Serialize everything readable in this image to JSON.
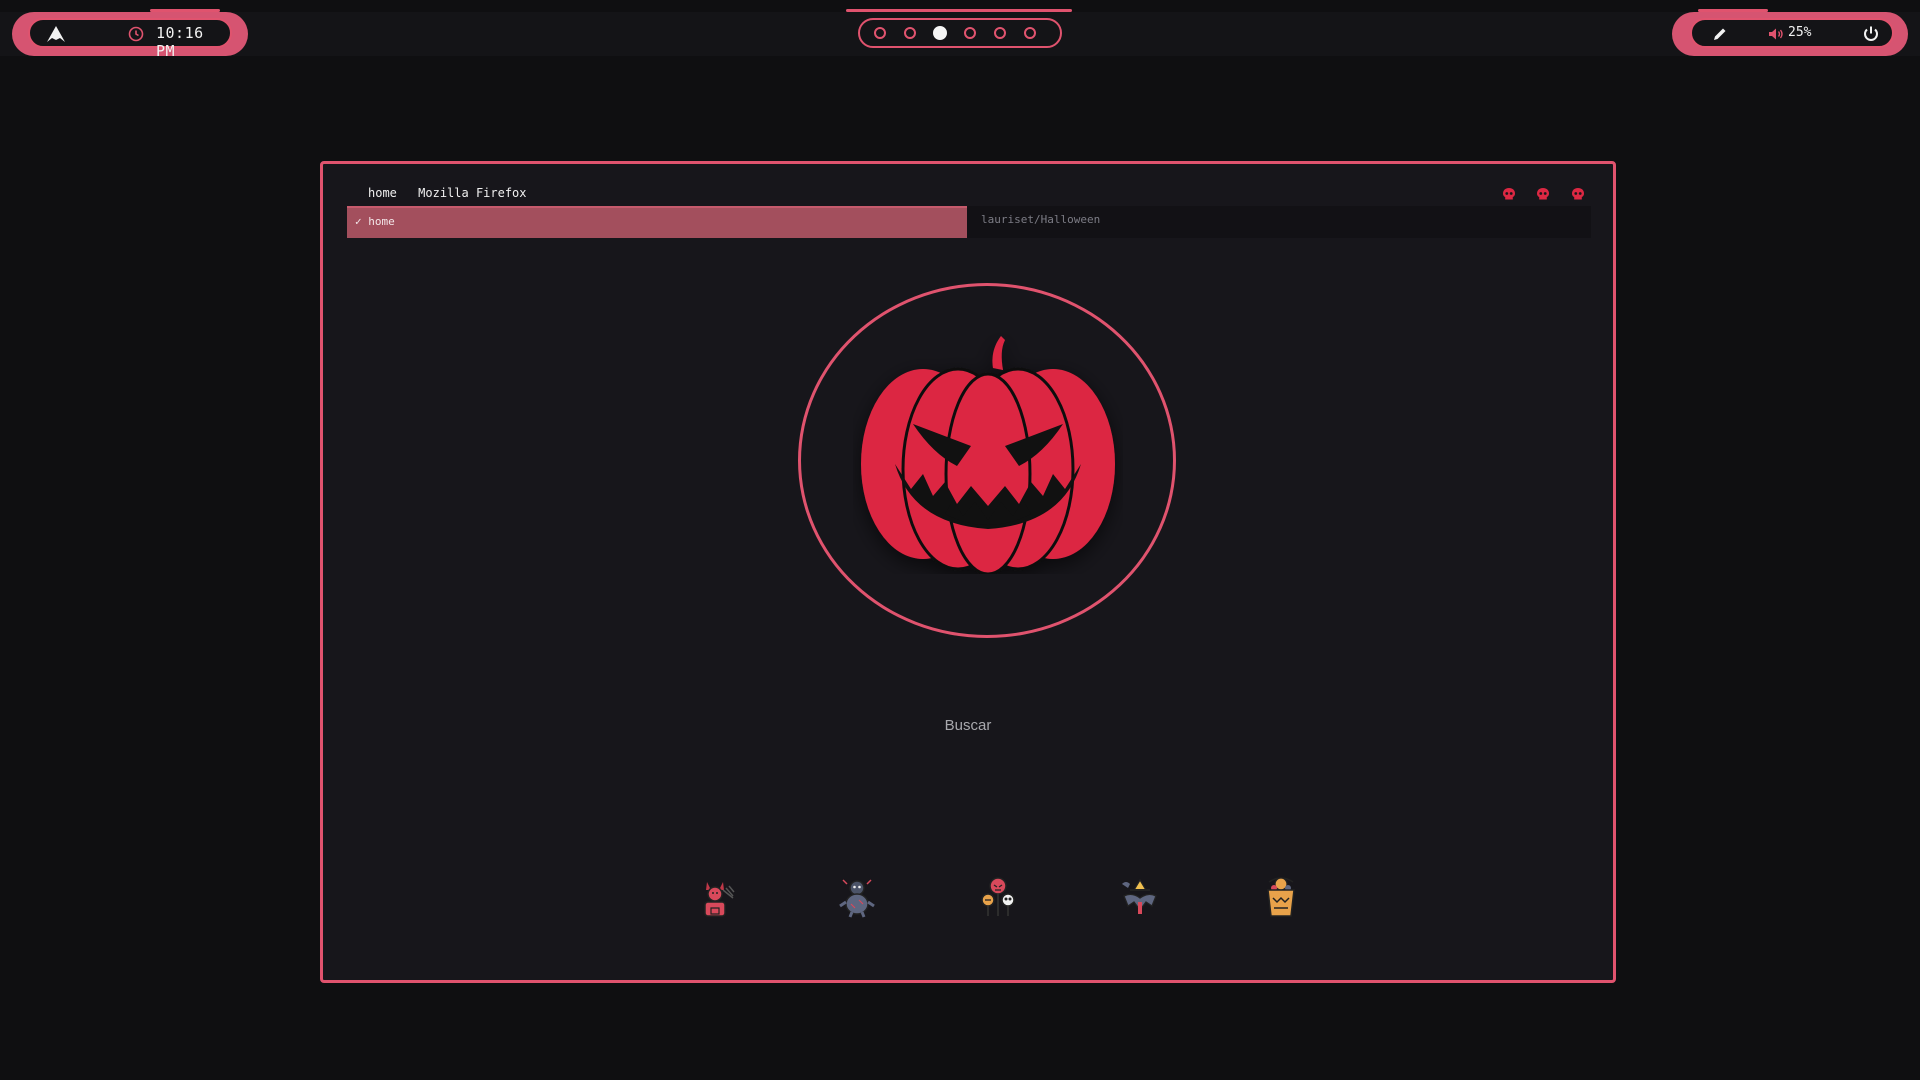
{
  "topbar": {
    "time": "10:16 PM",
    "volume": "25%",
    "workspaces": [
      {
        "active": false
      },
      {
        "active": false
      },
      {
        "active": true
      },
      {
        "active": false
      },
      {
        "active": false
      },
      {
        "active": false
      }
    ],
    "icons": [
      "arch-launcher-icon",
      "clock-icon",
      "edit-icon",
      "volume-icon",
      "power-icon"
    ]
  },
  "window": {
    "tab_titles": [
      "home",
      "Mozilla Firefox"
    ],
    "url_left": "✓ home",
    "url_right": "lauriset/Halloween",
    "search_label": "Buscar",
    "favorites": [
      "devil-icon",
      "scarecrow-icon",
      "ghost-pumpkins-icon",
      "witch-bat-icon",
      "candy-bucket-icon"
    ]
  },
  "colors": {
    "background": "#0f0f11",
    "accent": "#e0536e",
    "pumpkin": "#dc2843",
    "window_bg": "#17161b"
  }
}
